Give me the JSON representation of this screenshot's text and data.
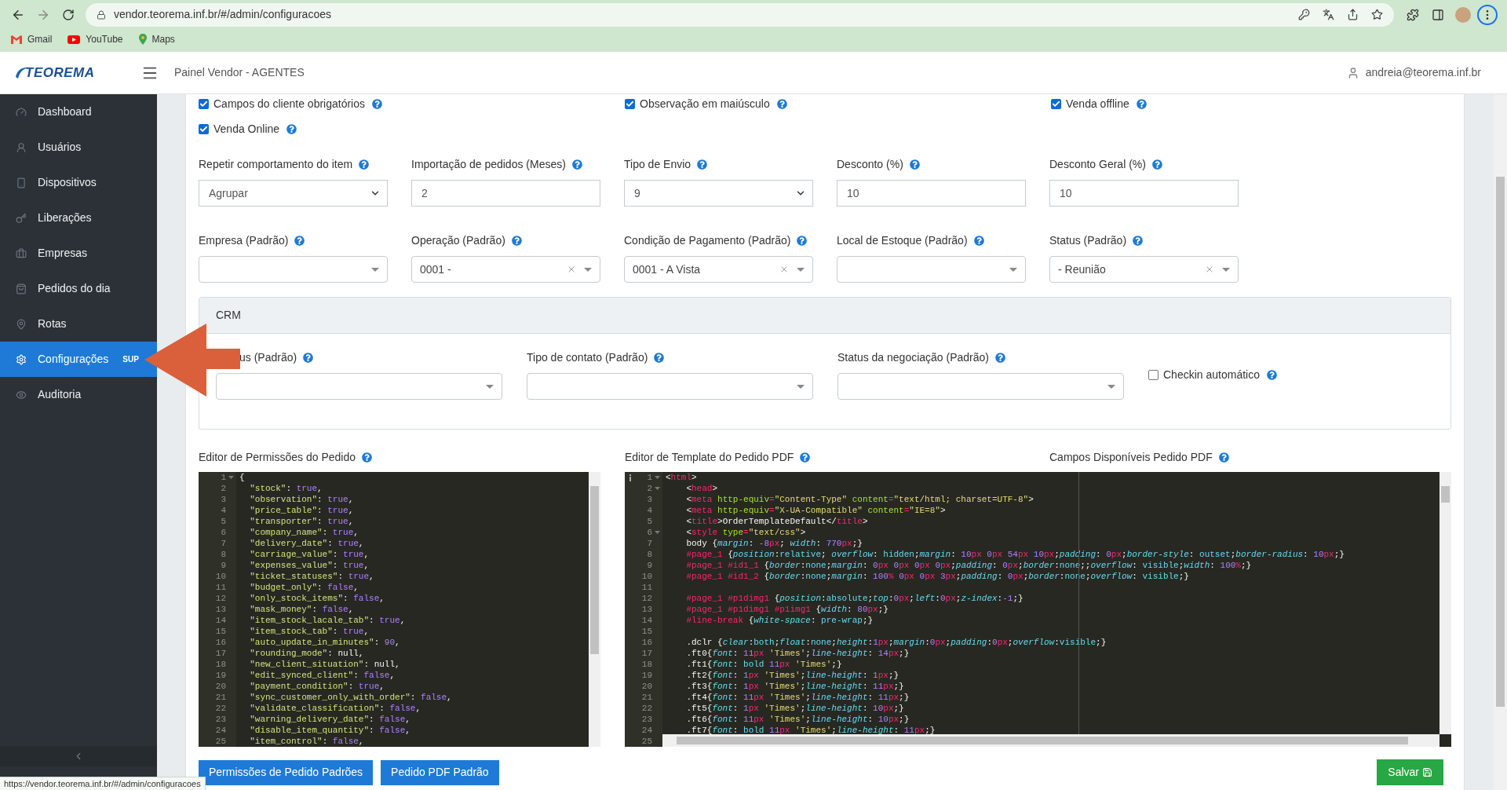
{
  "browser": {
    "url": "vendor.teorema.inf.br/#/admin/configuracoes",
    "bookmarks": [
      {
        "label": "Gmail",
        "kind": "gmail"
      },
      {
        "label": "YouTube",
        "kind": "youtube"
      },
      {
        "label": "Maps",
        "kind": "maps"
      }
    ],
    "status_url": "https://vendor.teorema.inf.br/#/admin/configuracoes"
  },
  "header": {
    "logo": "TEOREMA",
    "title": "Painel Vendor - AGENTES",
    "user": "andreia@teorema.inf.br"
  },
  "sidebar": {
    "items": [
      {
        "label": "Dashboard",
        "selected": false
      },
      {
        "label": "Usuários",
        "selected": false
      },
      {
        "label": "Dispositivos",
        "selected": false
      },
      {
        "label": "Liberações",
        "selected": false
      },
      {
        "label": "Empresas",
        "selected": false
      },
      {
        "label": "Pedidos do dia",
        "selected": false
      },
      {
        "label": "Rotas",
        "selected": false
      },
      {
        "label": "Configurações",
        "selected": true,
        "badge": "SUP"
      },
      {
        "label": "Auditoria",
        "selected": false
      }
    ]
  },
  "options": [
    {
      "label": "Campos do cliente obrigatórios",
      "checked": true
    },
    {
      "label": "Observação em maiúsculo",
      "checked": true
    },
    {
      "label": "Venda offline",
      "checked": true
    },
    {
      "label": "Venda Online",
      "checked": true
    }
  ],
  "fields": [
    {
      "label": "Repetir comportamento do item",
      "kind": "select",
      "value": "Agrupar"
    },
    {
      "label": "Importação de pedidos (Meses)",
      "kind": "input",
      "value": "2"
    },
    {
      "label": "Tipo de Envio",
      "kind": "select",
      "value": "9"
    },
    {
      "label": "Desconto (%)",
      "kind": "input",
      "value": "10"
    },
    {
      "label": "Desconto Geral (%)",
      "kind": "input",
      "value": "10"
    },
    {
      "label": "Empresa (Padrão)",
      "kind": "combo"
    },
    {
      "label": "Operação (Padrão)",
      "kind": "combo",
      "value": "0001 -",
      "clearable": true
    },
    {
      "label": "Condição de Pagamento (Padrão)",
      "kind": "combo",
      "value": "0001 - A Vista",
      "clearable": true
    },
    {
      "label": "Local de Estoque (Padrão)",
      "kind": "combo"
    },
    {
      "label": "Status (Padrão)",
      "kind": "combo",
      "value": "- Reunião",
      "clearable": true
    }
  ],
  "crm": {
    "title": "CRM",
    "fields": [
      {
        "label": "us (Padrão)",
        "kind": "combo"
      },
      {
        "label": "Tipo de contato (Padrão)",
        "kind": "combo"
      },
      {
        "label": "Status da negociação (Padrão)",
        "kind": "combo"
      }
    ],
    "checkbox": {
      "label": "Checkin automático",
      "checked": false
    }
  },
  "editors": [
    {
      "label": "Editor de Permissões do Pedido",
      "kind": "json",
      "lines": [
        {
          "number": "1",
          "text": "{",
          "fold": true
        },
        {
          "number": "2",
          "text": "  \"stock\": true,"
        },
        {
          "number": "3",
          "text": "  \"observation\": true,"
        },
        {
          "number": "4",
          "text": "  \"price_table\": true,"
        },
        {
          "number": "5",
          "text": "  \"transporter\": true,"
        },
        {
          "number": "6",
          "text": "  \"company_name\": true,"
        },
        {
          "number": "7",
          "text": "  \"delivery_date\": true,"
        },
        {
          "number": "8",
          "text": "  \"carriage_value\": true,"
        },
        {
          "number": "9",
          "text": "  \"expenses_value\": true,"
        },
        {
          "number": "10",
          "text": "  \"ticket_statuses\": true,"
        },
        {
          "number": "11",
          "text": "  \"budget_only\": false,"
        },
        {
          "number": "12",
          "text": "  \"only_stock_items\": false,"
        },
        {
          "number": "13",
          "text": "  \"mask_money\": false,"
        },
        {
          "number": "14",
          "text": "  \"item_stock_lacale_tab\": true,"
        },
        {
          "number": "15",
          "text": "  \"item_stock_tab\": true,"
        },
        {
          "number": "16",
          "text": "  \"auto_update_in_minutes\": 90,"
        },
        {
          "number": "17",
          "text": "  \"rounding_mode\": null,"
        },
        {
          "number": "18",
          "text": "  \"new_client_situation\": null,"
        },
        {
          "number": "19",
          "text": "  \"edit_synced_client\": false,"
        },
        {
          "number": "20",
          "text": "  \"payment_condition\": true,"
        },
        {
          "number": "21",
          "text": "  \"sync_customer_only_with_order\": false,"
        },
        {
          "number": "22",
          "text": "  \"validate_classification\": false,"
        },
        {
          "number": "23",
          "text": "  \"warning_delivery_date\": false,"
        },
        {
          "number": "24",
          "text": "  \"disable_item_quantity\": false,"
        },
        {
          "number": "25",
          "text": "  \"item_control\": false,"
        }
      ]
    },
    {
      "label": "Editor de Template do Pedido PDF",
      "kind": "html",
      "lines": [
        {
          "number": "1",
          "text": "<html>",
          "fold": true,
          "info": true
        },
        {
          "number": "2",
          "text": "    <head>",
          "fold": true
        },
        {
          "number": "3",
          "text": "    <meta http-equiv=\"Content-Type\" content=\"text/html; charset=UTF-8\">"
        },
        {
          "number": "4",
          "text": "    <meta http-equiv=\"X-UA-Compatible\" content=\"IE=8\">"
        },
        {
          "number": "5",
          "text": "    <title>OrderTemplateDefault</title>"
        },
        {
          "number": "6",
          "text": "    <style type=\"text/css\">",
          "fold": true
        },
        {
          "number": "7",
          "text": "    body {margin: -8px; width: 770px;}"
        },
        {
          "number": "8",
          "text": "    #page_1 {position:relative; overflow: hidden;margin: 10px 0px 54px 10px;padding: 0px;border-style: outset;border-radius: 10px;}"
        },
        {
          "number": "9",
          "text": "    #page_1 #id1_1 {border:none;margin: 0px 0px 0px 0px;padding: 0px;border:none;;overflow: visible;width: 100%;}"
        },
        {
          "number": "10",
          "text": "    #page_1 #id1_2 {border:none;margin: 100% 0px 0px 3px;padding: 0px;border:none;overflow: visible;}"
        },
        {
          "number": "11"
        },
        {
          "number": "12",
          "text": "    #page_1 #p1dimg1 {position:absolute;top:0px;left:0px;z-index:-1;}"
        },
        {
          "number": "13",
          "text": "    #page_1 #p1dimg1 #p1img1 {width: 80px;}"
        },
        {
          "number": "14",
          "text": "    #line-break {white-space: pre-wrap;}"
        },
        {
          "number": "15"
        },
        {
          "number": "16",
          "text": "    .dclr {clear:both;float:none;height:1px;margin:0px;padding:0px;overflow:visible;}"
        },
        {
          "number": "17",
          "text": "    .ft0{font: 11px 'Times';line-height: 14px;}"
        },
        {
          "number": "18",
          "text": "    .ft1{font: bold 11px 'Times';}"
        },
        {
          "number": "19",
          "text": "    .ft2{font: 1px 'Times';line-height: 1px;}"
        },
        {
          "number": "20",
          "text": "    .ft3{font: 1px 'Times';line-height: 11px;}"
        },
        {
          "number": "21",
          "text": "    .ft4{font: 11px 'Times';line-height: 11px;}"
        },
        {
          "number": "22",
          "text": "    .ft5{font: 1px 'Times';line-height: 10px;}"
        },
        {
          "number": "23",
          "text": "    .ft6{font: 11px 'Times';line-height: 10px;}"
        },
        {
          "number": "24",
          "text": "    .ft7{font: bold 11px 'Times';line-height: 11px;}"
        },
        {
          "number": "25"
        }
      ]
    }
  ],
  "available_fields": {
    "label": "Campos Disponíveis Pedido PDF"
  },
  "buttons": [
    {
      "label": "Permissões de Pedido Padrões"
    },
    {
      "label": "Pedido PDF Padrão"
    }
  ],
  "save_button": {
    "label": "Salvar"
  }
}
